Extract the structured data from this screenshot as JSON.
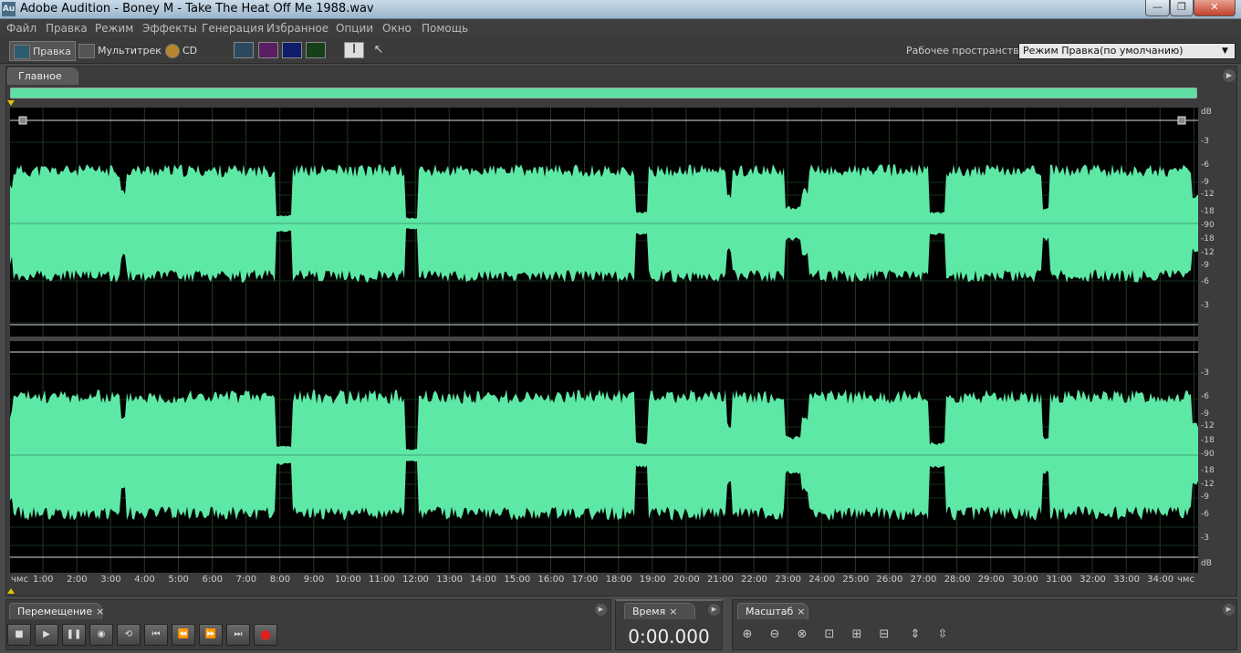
{
  "app": {
    "icon_text": "Au",
    "title": "Adobe Audition - Boney M - Take The Heat Off Me 1988.wav"
  },
  "window_controls": {
    "minimize": "—",
    "maximize": "❐",
    "close": "✕"
  },
  "menu": [
    "Файл",
    "Правка",
    "Режим",
    "Эффекты",
    "Генерация",
    "Избранное",
    "Опции",
    "Окно",
    "Помощь"
  ],
  "toolbar": {
    "edit_label": "Правка",
    "multitrack_label": "Мультитрек",
    "cd_label": "CD",
    "workspace_label": "Рабочее пространство:",
    "workspace_value": "Режим Правка(по умолчанию)"
  },
  "main_panel": {
    "tab_label": "Главное"
  },
  "db_scale": [
    "dB",
    "-3",
    "-6",
    "-9",
    "-12",
    "-18",
    "-90",
    "-18",
    "-12",
    "-9",
    "-6",
    "-3",
    "-3",
    "-6",
    "-9",
    "-12",
    "-18",
    "-90",
    "-18",
    "-12",
    "-9",
    "-6",
    "-3",
    "dB"
  ],
  "timeline": {
    "start_label": "чмс",
    "end_label": "чмс",
    "ticks": [
      "1:00",
      "2:00",
      "3:00",
      "4:00",
      "5:00",
      "6:00",
      "7:00",
      "8:00",
      "9:00",
      "10:00",
      "11:00",
      "12:00",
      "13:00",
      "14:00",
      "15:00",
      "16:00",
      "17:00",
      "18:00",
      "19:00",
      "20:00",
      "21:00",
      "22:00",
      "23:00",
      "24:00",
      "25:00",
      "26:00",
      "27:00",
      "28:00",
      "29:00",
      "30:00",
      "31:00",
      "32:00",
      "33:00",
      "34:00"
    ]
  },
  "transport": {
    "tab_label": "Перемещение",
    "close": "×"
  },
  "time_panel": {
    "tab_label": "Время",
    "close": "×",
    "value": "0:00.000"
  },
  "zoom_panel": {
    "tab_label": "Масштаб",
    "close": "×"
  },
  "colors": {
    "waveform": "#5ee8a6",
    "background": "#000000",
    "chrome": "#3c3c3c"
  }
}
